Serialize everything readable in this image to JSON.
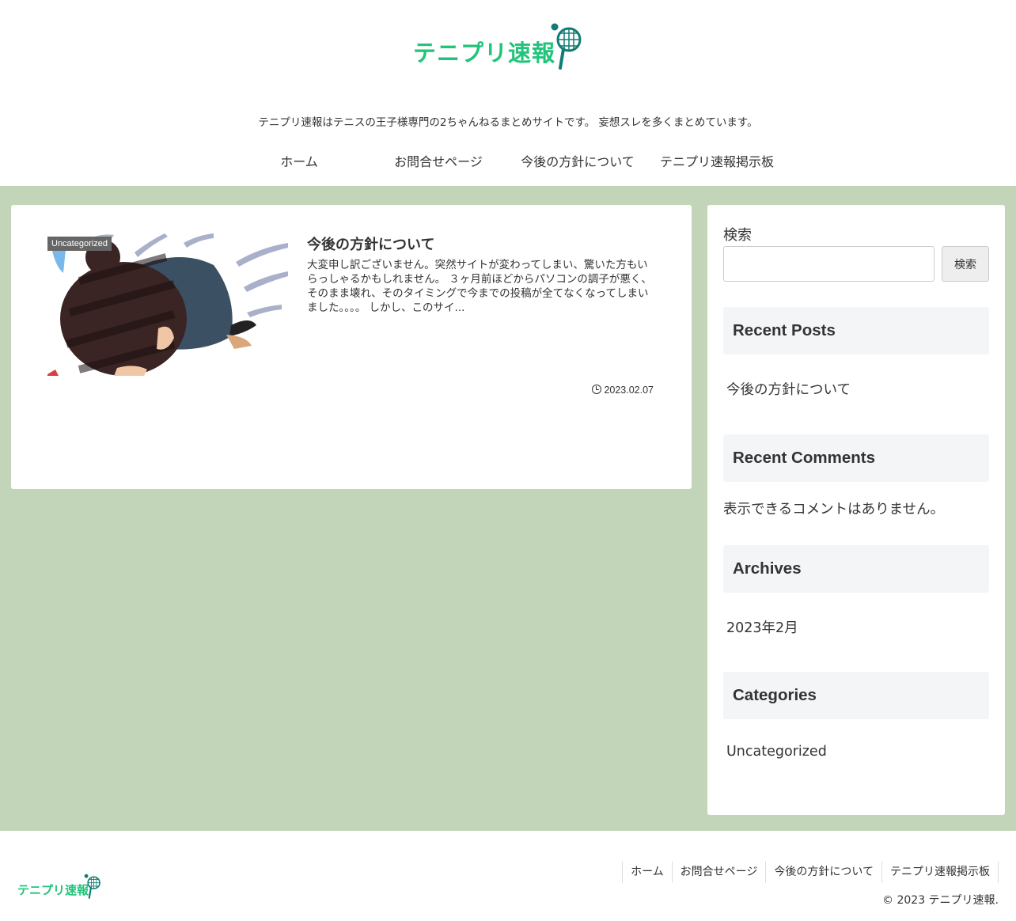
{
  "site": {
    "logo_text": "テニプリ速報",
    "tagline": "テニプリ速報はテニスの王子様専門の2ちゃんねるまとめサイトです。 妄想スレを多くまとめています。"
  },
  "nav": {
    "items": [
      "ホーム",
      "お問合せページ",
      "今後の方針について",
      "テニプリ速報掲示板"
    ]
  },
  "colors": {
    "brand_green": "#21c47a",
    "band_background": "#c3d5b9"
  },
  "post": {
    "category": "Uncategorized",
    "title": "今後の方針について",
    "snippet": "大変申し訳ございません。突然サイトが変わってしまい、驚いた方もいらっしゃるかもしれません。 ３ヶ月前ほどからパソコンの調子が悪く、そのまま壊れ、そのタイミングで今までの投稿が全てなくなってしまいました。。。。 しかし、このサイ...",
    "date": "2023.02.07"
  },
  "sidebar": {
    "search_label": "検索",
    "search_value": "",
    "search_button": "検索",
    "recent_posts_title": "Recent Posts",
    "recent_posts": [
      "今後の方針について"
    ],
    "recent_comments_title": "Recent Comments",
    "recent_comments_empty": "表示できるコメントはありません。",
    "archives_title": "Archives",
    "archives": [
      "2023年2月"
    ],
    "categories_title": "Categories",
    "categories": [
      "Uncategorized"
    ]
  },
  "footer": {
    "logo_text": "テニプリ速報",
    "nav": [
      "ホーム",
      "お問合せページ",
      "今後の方針について",
      "テニプリ速報掲示板"
    ],
    "copyright": "© 2023 テニプリ速報."
  }
}
